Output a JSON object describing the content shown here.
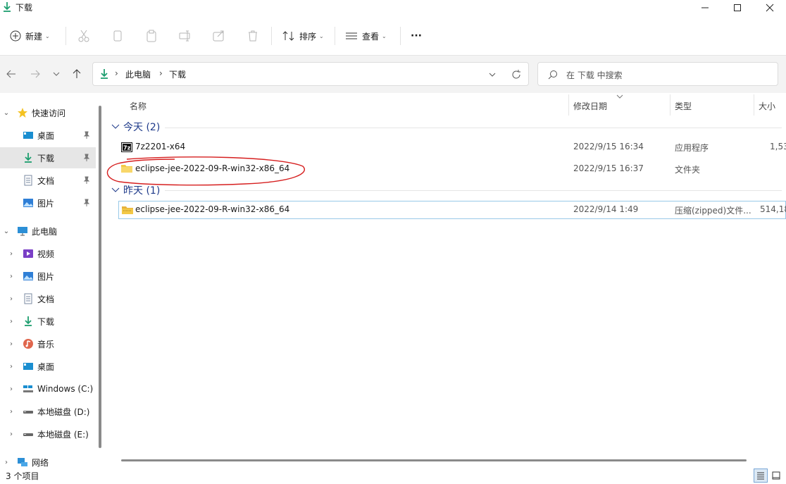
{
  "window": {
    "title": "下载"
  },
  "toolbar": {
    "new_label": "新建",
    "sort_label": "排序",
    "view_label": "查看",
    "more_label": "···"
  },
  "address": {
    "crumbs": [
      "此电脑",
      "下载"
    ],
    "search_placeholder": "在 下载 中搜索"
  },
  "sidebar": {
    "quick_access": "快速访问",
    "pinned": [
      {
        "label": "桌面",
        "icon": "desktop-icon"
      },
      {
        "label": "下载",
        "icon": "download-icon"
      },
      {
        "label": "文档",
        "icon": "document-icon"
      },
      {
        "label": "图片",
        "icon": "picture-icon"
      }
    ],
    "this_pc": "此电脑",
    "pc_items": [
      {
        "label": "视频",
        "icon": "video-icon"
      },
      {
        "label": "图片",
        "icon": "picture-icon"
      },
      {
        "label": "文档",
        "icon": "document-icon"
      },
      {
        "label": "下载",
        "icon": "download-icon"
      },
      {
        "label": "音乐",
        "icon": "music-icon"
      },
      {
        "label": "桌面",
        "icon": "desktop-icon"
      },
      {
        "label": "Windows (C:)",
        "icon": "windows-drive-icon"
      },
      {
        "label": "本地磁盘 (D:)",
        "icon": "drive-icon"
      },
      {
        "label": "本地磁盘 (E:)",
        "icon": "drive-icon"
      }
    ],
    "network": "网络"
  },
  "columns": {
    "name": "名称",
    "modified": "修改日期",
    "type": "类型",
    "size": "大小"
  },
  "groups": [
    {
      "header": "今天 (2)",
      "files": [
        {
          "name": "7z2201-x64",
          "modified": "2022/9/15 16:34",
          "type": "应用程序",
          "size": "1,53",
          "icon": "7zip-app-icon"
        },
        {
          "name": "eclipse-jee-2022-09-R-win32-x86_64",
          "modified": "2022/9/15 16:37",
          "type": "文件夹",
          "size": "",
          "icon": "folder-icon"
        }
      ]
    },
    {
      "header": "昨天 (1)",
      "files": [
        {
          "name": "eclipse-jee-2022-09-R-win32-x86_64",
          "modified": "2022/9/14 1:49",
          "type": "压缩(zipped)文件...",
          "size": "514,18",
          "icon": "zip-folder-icon"
        }
      ]
    }
  ],
  "status": {
    "item_count": "3 个项目"
  },
  "colors": {
    "accent": "#1e3a8a",
    "selected_border": "#99c9e8",
    "annotation": "#d61f1f",
    "folder": "#f3c846"
  }
}
